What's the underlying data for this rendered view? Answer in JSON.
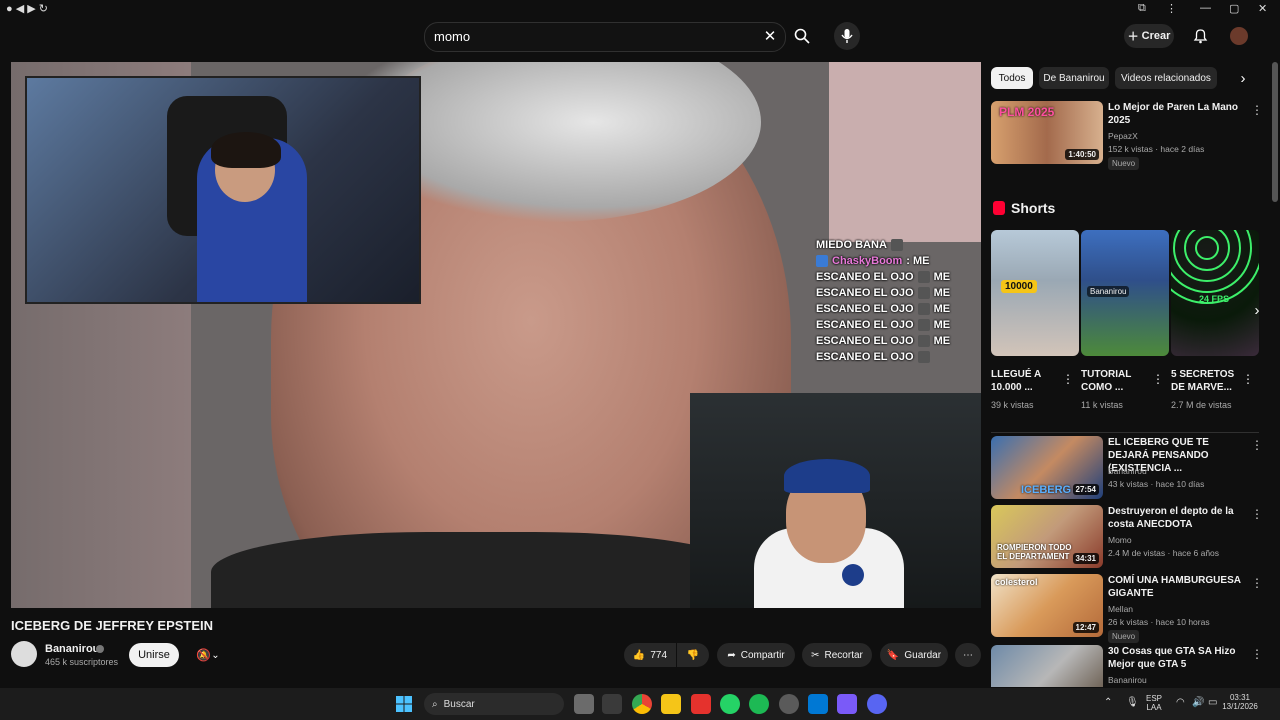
{
  "search": {
    "query": "momo"
  },
  "header": {
    "create_label": "Crear"
  },
  "video": {
    "title": "ICEBERG DE JEFFREY EPSTEIN",
    "channel": "Bananirou",
    "subscribers": "465 k suscriptores",
    "join_label": "Unirse",
    "likes": "774",
    "share_label": "Compartir",
    "clip_label": "Recortar",
    "save_label": "Guardar"
  },
  "chat_overlay": [
    {
      "user": "",
      "text": "MIEDO BANA"
    },
    {
      "user": "ChaskyBoom",
      "text": ": ME"
    },
    {
      "user": "",
      "text": "ESCANEO EL OJO",
      "suffix": "ME"
    },
    {
      "user": "",
      "text": "ESCANEO EL OJO",
      "suffix": "ME"
    },
    {
      "user": "",
      "text": "ESCANEO EL OJO",
      "suffix": "ME"
    },
    {
      "user": "",
      "text": "ESCANEO EL OJO",
      "suffix": "ME"
    },
    {
      "user": "",
      "text": "ESCANEO EL OJO",
      "suffix": "ME"
    },
    {
      "user": "",
      "text": "ESCANEO EL OJO",
      "suffix": ""
    }
  ],
  "chips": [
    "Todos",
    "De Bananirou",
    "Videos relacionados"
  ],
  "recommended_top": {
    "title": "Lo Mejor de Paren La Mano 2025",
    "channel": "PepazX",
    "meta": "152 k vistas · hace 2 días",
    "badge": "Nuevo",
    "duration": "1:40:50",
    "thumb_text": "PLM 2025"
  },
  "shorts": {
    "heading": "Shorts",
    "items": [
      {
        "title": "LLEGUÉ A 10.000 ...",
        "views": "39 k vistas",
        "overlay": "10000"
      },
      {
        "title": "TUTORIAL COMO ...",
        "views": "11 k vistas",
        "overlay": "Bananirou"
      },
      {
        "title": "5 SECRETOS DE MARVE...",
        "views": "2.7 M de vistas",
        "overlay": "24 FPS"
      }
    ]
  },
  "recommended": [
    {
      "title": "EL ICEBERG QUE TE DEJARÁ PENSANDO (EXISTENCIA ...",
      "channel": "Bananirou",
      "meta": "43 k vistas · hace 10 días",
      "duration": "27:54",
      "badge": "",
      "thumb_text": "ICEBERG"
    },
    {
      "title": "Destruyeron el depto de la costa ANECDOTA",
      "channel": "Momo",
      "meta": "2.4 M de vistas · hace 6 años",
      "duration": "34:31",
      "badge": "",
      "thumb_text": "ROMPIERON TODO EL DEPARTAMENT"
    },
    {
      "title": "COMÍ UNA HAMBURGUESA GIGANTE",
      "channel": "Mellan",
      "meta": "26 k vistas · hace 10 horas",
      "duration": "12:47",
      "badge": "Nuevo",
      "thumb_text": "colesterol"
    },
    {
      "title": "30 Cosas que GTA SA Hizo Mejor que GTA 5",
      "channel": "Bananirou",
      "meta": "",
      "duration": "",
      "badge": "",
      "thumb_text": ""
    }
  ],
  "taskbar": {
    "search_label": "Buscar",
    "lang": "ESP",
    "lang2": "LAA",
    "time": "03:31",
    "date": "13/1/2026"
  },
  "colors": {
    "accent": "#ff0033",
    "background": "#0f0f0f",
    "chip_active": "#f1f1f1"
  }
}
